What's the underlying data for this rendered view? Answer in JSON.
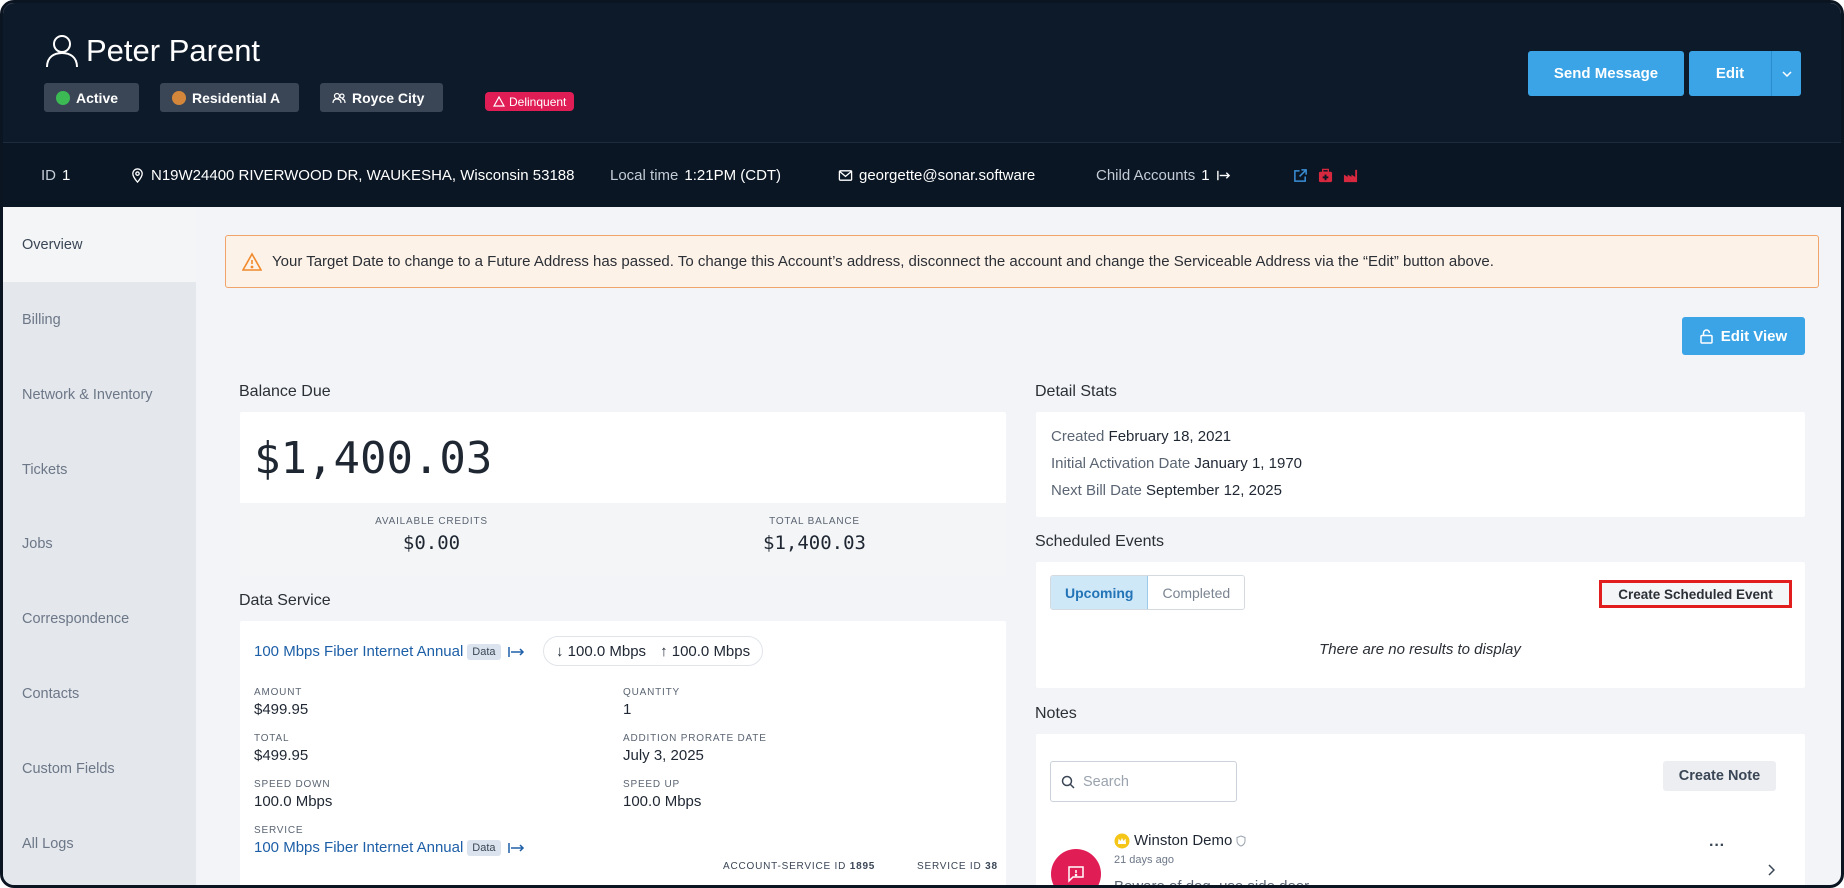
{
  "header": {
    "account_name": "Peter Parent",
    "badges": [
      {
        "label": "Active",
        "dot_color": "#3cba54"
      },
      {
        "label": "Residential A",
        "dot_color": "#d4873a"
      },
      {
        "label": "Royce City"
      }
    ],
    "delinquent_label": "Delinquent",
    "send_message_label": "Send Message",
    "edit_label": "Edit"
  },
  "infobar": {
    "id_label": "ID",
    "id_value": "1",
    "address": "N19W24400 RIVERWOOD DR, WAUKESHA, Wisconsin 53188",
    "local_time_label": "Local time",
    "local_time_value": "1:21PM (CDT)",
    "email": "georgette@sonar.software",
    "child_accounts_label": "Child Accounts",
    "child_accounts_value": "1"
  },
  "sidebar": {
    "items": [
      {
        "label": "Overview"
      },
      {
        "label": "Billing"
      },
      {
        "label": "Network & Inventory"
      },
      {
        "label": "Tickets"
      },
      {
        "label": "Jobs"
      },
      {
        "label": "Correspondence"
      },
      {
        "label": "Contacts"
      },
      {
        "label": "Custom Fields"
      },
      {
        "label": "All Logs"
      }
    ]
  },
  "alert": {
    "text": "Your Target Date to change to a Future Address has passed. To change this Account’s address, disconnect the account and change the Serviceable Address via the “Edit” button above."
  },
  "edit_view_label": "Edit View",
  "balance": {
    "title": "Balance Due",
    "amount": "$1,400.03",
    "available_credits_label": "AVAILABLE CREDITS",
    "available_credits_value": "$0.00",
    "total_balance_label": "TOTAL BALANCE",
    "total_balance_value": "$1,400.03"
  },
  "data_service": {
    "title": "Data Service",
    "plan_link": "100 Mbps Fiber Internet Annual",
    "tag": "Data",
    "speed_down": "100.0 Mbps",
    "speed_up": "100.0 Mbps",
    "fields": {
      "amount_label": "AMOUNT",
      "amount_value": "$499.95",
      "quantity_label": "QUANTITY",
      "quantity_value": "1",
      "total_label": "TOTAL",
      "total_value": "$499.95",
      "prorate_label": "ADDITION PRORATE DATE",
      "prorate_value": "July 3, 2025",
      "speed_down_label": "SPEED DOWN",
      "speed_down_value": "100.0 Mbps",
      "speed_up_label": "SPEED UP",
      "speed_up_value": "100.0 Mbps",
      "service_label": "SERVICE",
      "service_value": "100 Mbps Fiber Internet Annual"
    },
    "account_service_id_label": "ACCOUNT-SERVICE ID",
    "account_service_id_value": "1895",
    "service_id_label": "SERVICE ID",
    "service_id_value": "38"
  },
  "detail_stats": {
    "title": "Detail Stats",
    "created_label": "Created",
    "created_value": "February 18, 2021",
    "activation_label": "Initial Activation Date",
    "activation_value": "January 1, 1970",
    "next_bill_label": "Next Bill Date",
    "next_bill_value": "September 12, 2025"
  },
  "scheduled_events": {
    "title": "Scheduled Events",
    "tab_upcoming": "Upcoming",
    "tab_completed": "Completed",
    "create_label": "Create Scheduled Event",
    "empty_text": "There are no results to display"
  },
  "notes": {
    "title": "Notes",
    "search_placeholder": "Search",
    "create_label": "Create Note",
    "items": [
      {
        "author": "Winston Demo",
        "time": "21 days ago",
        "preview": "Beware of dog, use side door"
      }
    ]
  },
  "colors": {
    "header_bg": "#0d1a29",
    "accent_blue": "#3aa4e6",
    "delinquent_red": "#e11d56",
    "highlight_red": "#e11d1d"
  }
}
